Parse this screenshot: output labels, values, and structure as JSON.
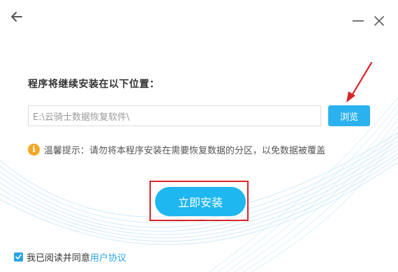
{
  "header": {
    "back_icon": "arrow-left-icon",
    "minimize_icon": "minimize-icon",
    "close_icon": "close-icon"
  },
  "install": {
    "location_label": "程序将继续安装在以下位置：",
    "path_value": "E:\\云骑士数据恢复软件\\",
    "browse_label": "浏览",
    "tip_icon": "info-icon",
    "tip_glyph": "i",
    "tip_text": "温馨提示：请勿将本程序安装在需要恢复数据的分区，以免数据被覆盖",
    "install_label": "立即安装"
  },
  "agreement": {
    "checked": true,
    "text": "我已阅读并同意",
    "link_text": "用户协议"
  },
  "colors": {
    "accent": "#1fb7ef",
    "annotation_red": "#d9252a",
    "tip_orange": "#f5a623"
  }
}
